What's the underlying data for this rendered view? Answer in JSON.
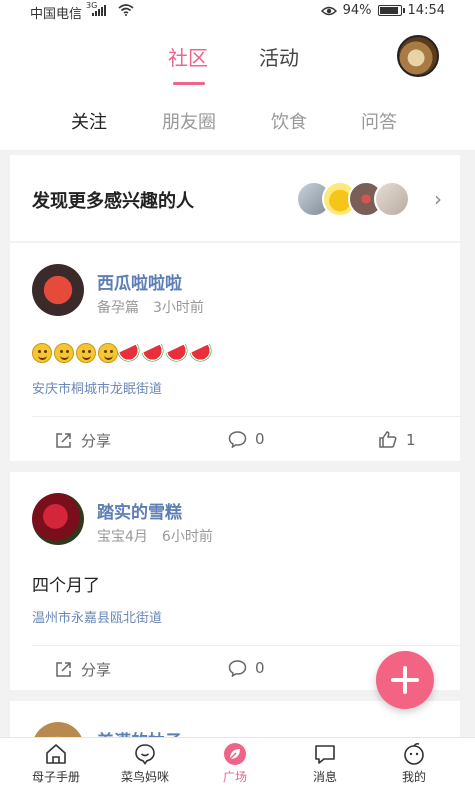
{
  "status_bar": {
    "carrier": "中国电信",
    "network": "3G",
    "battery": "94%",
    "time": "14:54"
  },
  "header": {
    "tabs": [
      {
        "label": "社区"
      },
      {
        "label": "活动"
      }
    ],
    "sub_tabs": [
      {
        "label": "关注"
      },
      {
        "label": "朋友圈"
      },
      {
        "label": "饮食"
      },
      {
        "label": "问答"
      }
    ]
  },
  "discover": {
    "title": "发现更多感兴趣的人"
  },
  "posts": [
    {
      "author": "西瓜啦啦啦",
      "category": "备孕篇",
      "time": "3小时前",
      "content": "",
      "location": "安庆市桐城市龙眠街道",
      "share_label": "分享",
      "comments": "0",
      "likes": "1"
    },
    {
      "author": "踏实的雪糕",
      "category": "宝宝4月",
      "time": "6小时前",
      "content": "四个月了",
      "location": "温州市永嘉县瓯北街道",
      "share_label": "分享",
      "comments": "0"
    },
    {
      "author": "美满的柚子"
    }
  ],
  "bottom_nav": [
    {
      "label": "母子手册",
      "icon": "home-icon"
    },
    {
      "label": "菜鸟妈咪",
      "icon": "chat-bubble-icon"
    },
    {
      "label": "广场",
      "icon": "leaf-icon"
    },
    {
      "label": "消息",
      "icon": "message-icon"
    },
    {
      "label": "我的",
      "icon": "profile-icon"
    }
  ],
  "colors": {
    "accent": "#f06489",
    "link": "#5d7fb5",
    "fab": "#f26384"
  }
}
